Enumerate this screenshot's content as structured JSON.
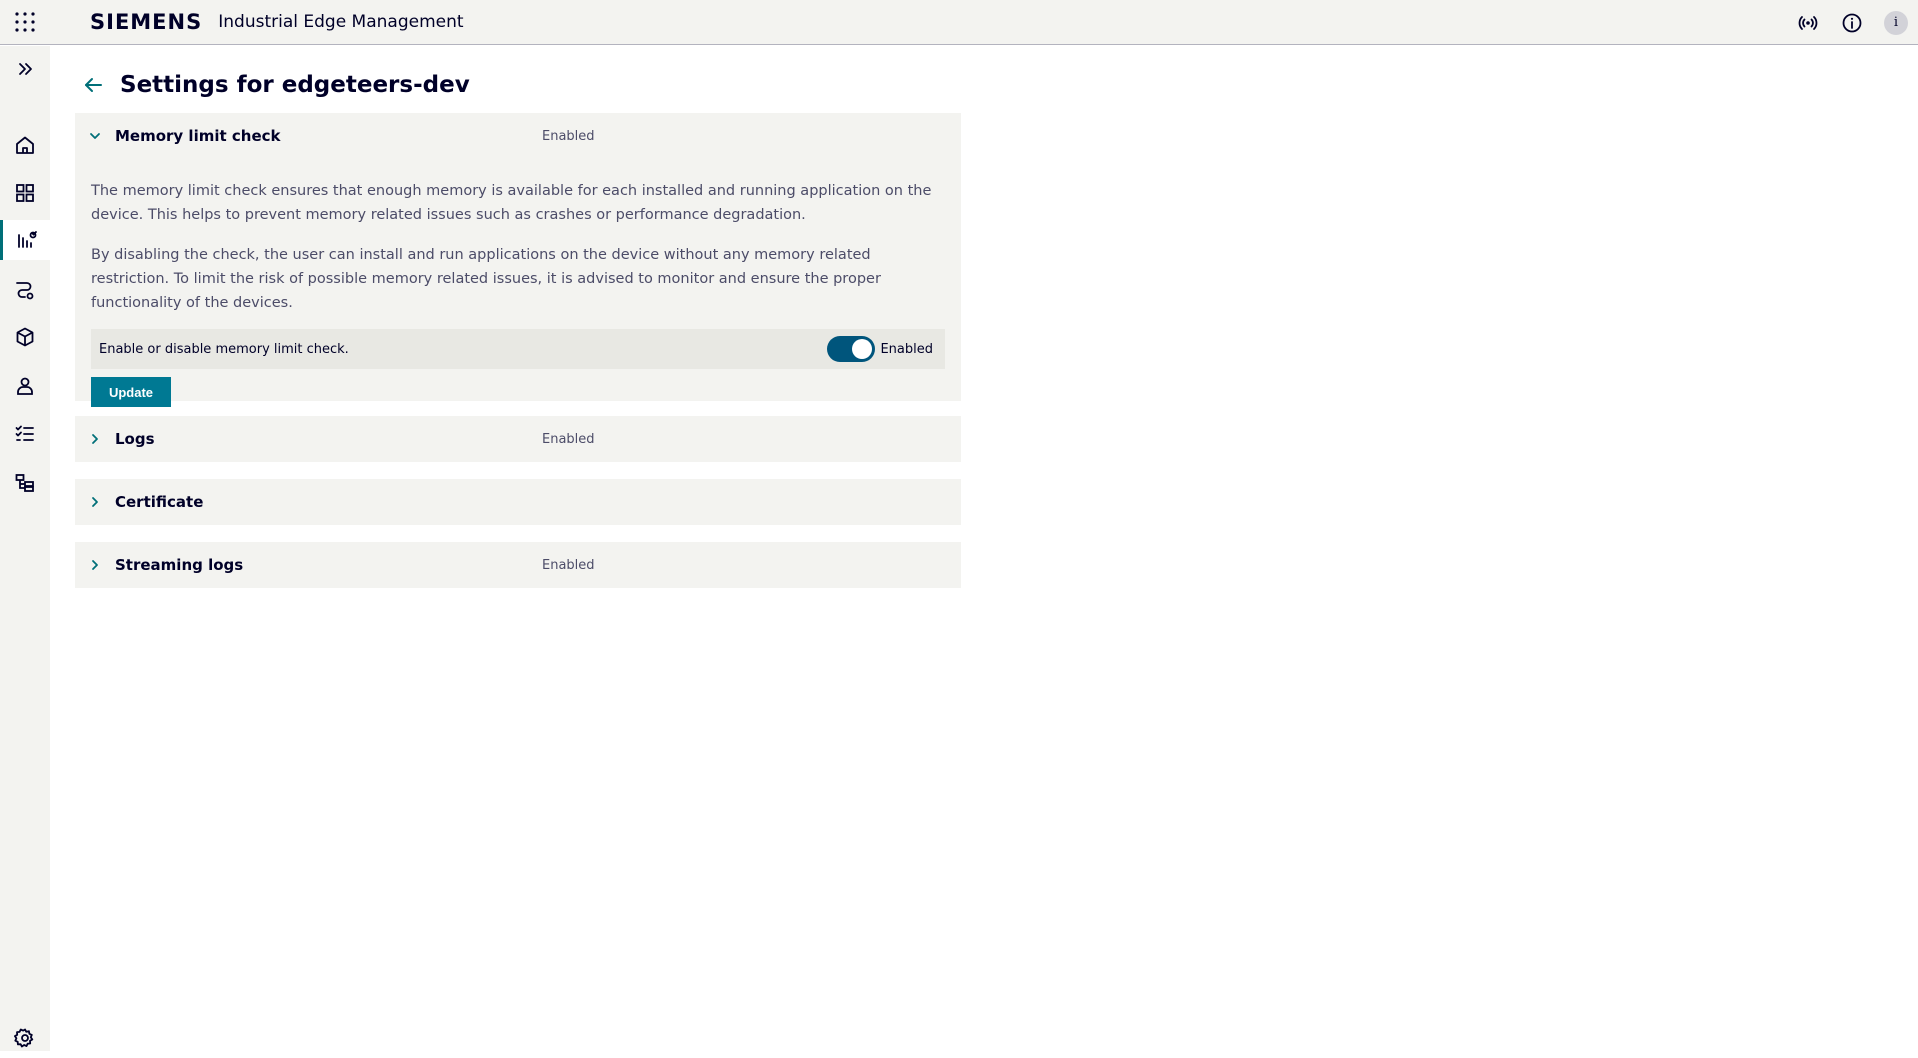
{
  "header": {
    "brand": "SIEMENS",
    "app_name": "Industrial Edge Management",
    "avatar_initial": "i"
  },
  "sidebar": {
    "items": [
      {
        "name": "expand",
        "icon": "double-chevron-right-icon"
      },
      {
        "name": "home",
        "icon": "home-icon"
      },
      {
        "name": "dashboard",
        "icon": "grid-icon"
      },
      {
        "name": "devices",
        "icon": "device-config-icon",
        "active": true
      },
      {
        "name": "flows",
        "icon": "flow-icon"
      },
      {
        "name": "apps",
        "icon": "box-icon"
      },
      {
        "name": "users",
        "icon": "user-icon"
      },
      {
        "name": "tasks",
        "icon": "checklist-icon"
      },
      {
        "name": "network",
        "icon": "network-icon"
      },
      {
        "name": "settings",
        "icon": "gear-icon"
      }
    ]
  },
  "page": {
    "title": "Settings for edgeteers-dev"
  },
  "panels": {
    "memory": {
      "title": "Memory limit check",
      "status": "Enabled",
      "desc1": "The memory limit check ensures that enough memory is available for each installed and running application on the device. This helps to prevent memory related issues such as crashes or performance degradation.",
      "desc2": "By disabling the check, the user can install and run applications on the device without any memory related restriction. To limit the risk of possible memory related issues, it is advised to monitor and ensure the proper functionality of the devices.",
      "toggle_label": "Enable or disable memory limit check.",
      "toggle_state": "Enabled",
      "update_label": "Update"
    },
    "logs": {
      "title": "Logs",
      "status": "Enabled"
    },
    "certificate": {
      "title": "Certificate"
    },
    "streaming": {
      "title": "Streaming logs",
      "status": "Enabled"
    }
  },
  "colors": {
    "accent": "#007993",
    "toggle_on": "#00557c",
    "panel_bg": "#f3f3f0"
  }
}
